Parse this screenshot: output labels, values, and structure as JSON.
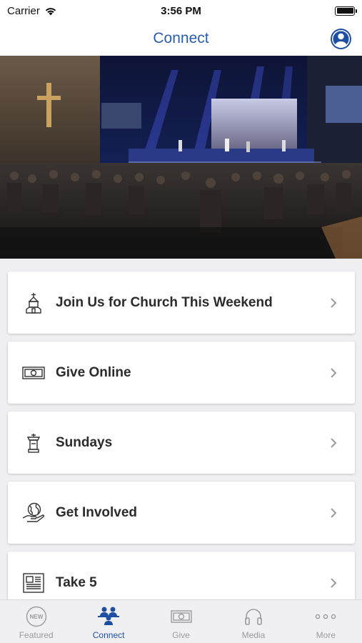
{
  "status_bar": {
    "carrier": "Carrier",
    "time": "3:56 PM"
  },
  "nav": {
    "title": "Connect",
    "profile_icon": "person-icon"
  },
  "hero": {
    "description_icon": "church-worship-photo"
  },
  "items": [
    {
      "label": "Join Us for Church This Weekend",
      "icon": "church-icon"
    },
    {
      "label": "Give Online",
      "icon": "money-icon"
    },
    {
      "label": "Sundays",
      "icon": "pulpit-icon"
    },
    {
      "label": "Get Involved",
      "icon": "globe-hand-icon"
    },
    {
      "label": "Take 5",
      "icon": "newspaper-icon"
    }
  ],
  "tabs": [
    {
      "label": "Featured",
      "icon": "new-badge-icon",
      "active": false
    },
    {
      "label": "Connect",
      "icon": "people-icon",
      "active": true
    },
    {
      "label": "Give",
      "icon": "money-icon",
      "active": false
    },
    {
      "label": "Media",
      "icon": "headphones-icon",
      "active": false
    },
    {
      "label": "More",
      "icon": "ellipsis-icon",
      "active": false
    }
  ],
  "colors": {
    "accent": "#1f4fa3",
    "title": "#2a5db0",
    "inactive": "#9a9aa0"
  }
}
